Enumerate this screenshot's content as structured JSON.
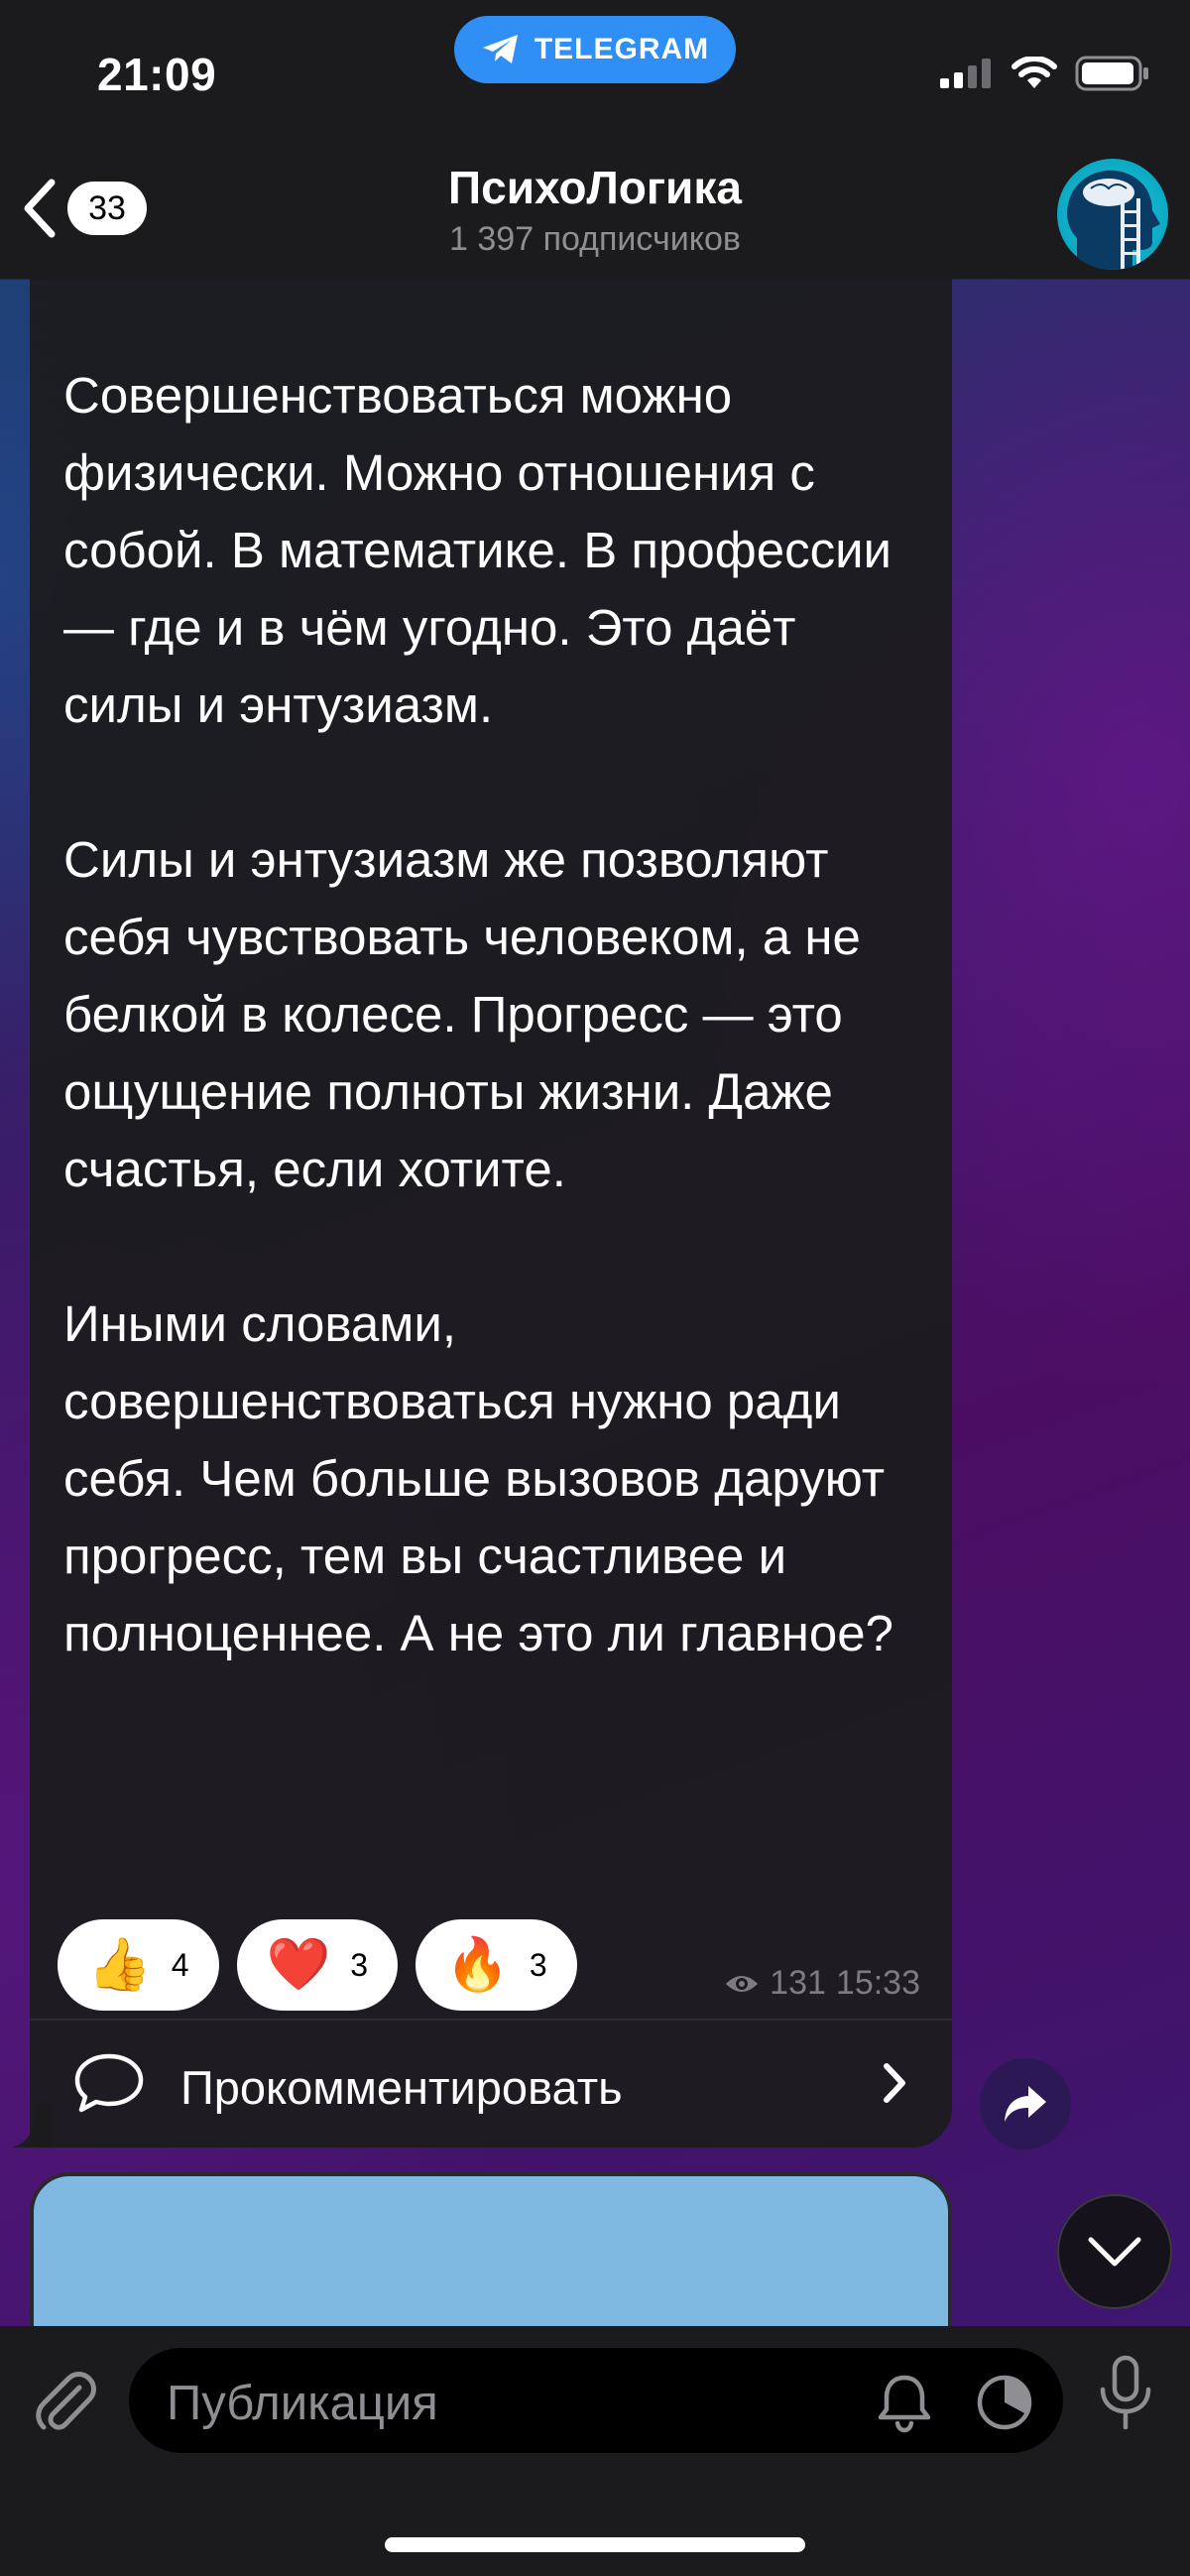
{
  "status_bar": {
    "time": "21:09",
    "app_pill_label": "TELEGRAM"
  },
  "header": {
    "back_count": "33",
    "channel_title": "ПсихоЛогика",
    "subscribers": "1 397 подписчиков"
  },
  "message": {
    "text": "Совершенствоваться можно физически. Можно отношения с собой. В математике. В профессии — где и в чём угодно. Это даёт силы и энтузиазм.\n\nСилы и энтузиазм же позволяют себя чувствовать человеком, а не белкой в колесе. Прогресс — это ощущение полноты жизни. Даже счастья, если хотите.\n\nИными словами, совершенствоваться нужно ради себя. Чем больше вызовов даруют прогресс, тем вы счастливее и полноценнее. А не это ли главное?",
    "reactions": [
      {
        "emoji": "👍",
        "count": "4"
      },
      {
        "emoji": "❤️",
        "count": "3"
      },
      {
        "emoji": "🔥",
        "count": "3"
      }
    ],
    "views": "131",
    "time": "15:33",
    "comment_label": "Прокомментировать"
  },
  "composer": {
    "placeholder": "Публикация"
  },
  "colors": {
    "accent_blue": "#2f8ff5",
    "bubble_bg": "#1c1c1e",
    "next_bubble": "#7fb8e0"
  },
  "icons": [
    "telegram-plane-icon",
    "signal-icon",
    "wifi-icon",
    "battery-icon",
    "chevron-left-icon",
    "eye-icon",
    "comment-bubble-icon",
    "chevron-right-icon",
    "share-arrow-icon",
    "chevron-down-icon",
    "paperclip-icon",
    "bell-icon",
    "timer-icon",
    "microphone-icon"
  ]
}
